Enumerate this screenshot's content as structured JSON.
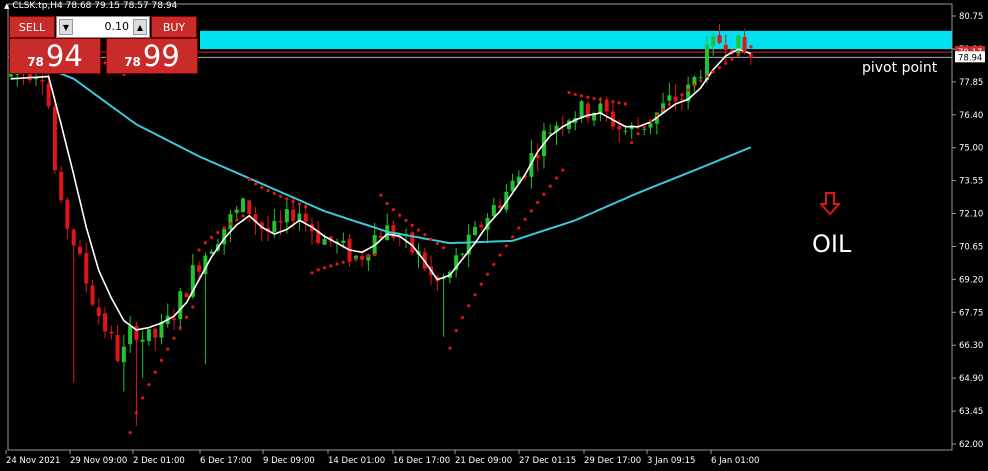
{
  "header": {
    "symbol_info": "CLSK.tp,H4",
    "ohlc": "78.68 79.15 78.57 78.94"
  },
  "trade_panel": {
    "sell_label": "SELL",
    "buy_label": "BUY",
    "volume": "0.10",
    "sell_price_prefix": "78",
    "sell_price_big": "94",
    "buy_price_prefix": "78",
    "buy_price_big": "99"
  },
  "annotations": {
    "pivot_label": "pivot point",
    "oil_label": "OIL"
  },
  "colors": {
    "bull": "#22c32e",
    "bear": "#e01515",
    "ma_slow": "#3cc8d8",
    "ma_fast": "#ffffff",
    "psar": "#e01515",
    "pivot_zone": "#00e0f0",
    "price_tag": "#c92a2a"
  },
  "chart_data": {
    "type": "candlestick",
    "title": "",
    "ylim": [
      62.0,
      81.2
    ],
    "y_ticks": [
      "80.75",
      "79.30",
      "77.85",
      "76.40",
      "75.00",
      "73.55",
      "72.10",
      "70.65",
      "69.20",
      "67.75",
      "66.30",
      "64.90",
      "63.45",
      "62.00"
    ],
    "x_ticks": [
      "24 Nov 2021",
      "29 Nov 09:00",
      "2 Dec 01:00",
      "6 Dec 17:00",
      "9 Dec 09:00",
      "14 Dec 01:00",
      "16 Dec 17:00",
      "21 Dec 09:00",
      "27 Dec 01:15",
      "29 Dec 17:00",
      "3 Jan 09:15",
      "6 Jan 01:00"
    ],
    "bar_count": 120,
    "current_price": "78.94",
    "price_marker_2": "79.17",
    "pivot_zone": [
      79.3,
      80.1
    ],
    "pivot_line": 79.17,
    "price_path": [
      [
        0,
        78.1
      ],
      [
        4,
        78.4
      ],
      [
        6,
        78.3
      ],
      [
        8,
        72.5
      ],
      [
        10,
        71.3
      ],
      [
        12,
        69.5
      ],
      [
        14,
        68.0
      ],
      [
        16,
        66.8
      ],
      [
        18,
        65.6
      ],
      [
        20,
        67.2
      ],
      [
        22,
        66.5
      ],
      [
        24,
        66.8
      ],
      [
        26,
        67.5
      ],
      [
        28,
        68.6
      ],
      [
        30,
        69.8
      ],
      [
        33,
        71.0
      ],
      [
        36,
        72.0
      ],
      [
        38,
        72.5
      ],
      [
        40,
        71.6
      ],
      [
        42,
        71.2
      ],
      [
        44,
        71.6
      ],
      [
        46,
        72.4
      ],
      [
        48,
        71.6
      ],
      [
        50,
        71.0
      ],
      [
        52,
        70.8
      ],
      [
        54,
        70.4
      ],
      [
        56,
        70.1
      ],
      [
        58,
        71.0
      ],
      [
        60,
        71.4
      ],
      [
        62,
        71.2
      ],
      [
        64,
        70.6
      ],
      [
        66,
        70.1
      ],
      [
        68,
        69.0
      ],
      [
        70,
        69.2
      ],
      [
        72,
        70.3
      ],
      [
        74,
        70.9
      ],
      [
        76,
        71.9
      ],
      [
        78,
        72.5
      ],
      [
        80,
        73.2
      ],
      [
        82,
        73.9
      ],
      [
        84,
        74.8
      ],
      [
        86,
        75.7
      ],
      [
        88,
        76.2
      ],
      [
        90,
        76.5
      ],
      [
        92,
        76.6
      ],
      [
        94,
        76.7
      ],
      [
        96,
        76.3
      ],
      [
        98,
        75.7
      ],
      [
        100,
        75.8
      ],
      [
        102,
        76.1
      ],
      [
        104,
        76.6
      ],
      [
        106,
        77.1
      ],
      [
        108,
        77.2
      ],
      [
        110,
        78.2
      ],
      [
        112,
        79.3
      ],
      [
        114,
        79.8
      ],
      [
        116,
        79.6
      ],
      [
        117,
        79.2
      ],
      [
        118,
        78.94
      ]
    ],
    "spikes": [
      [
        10,
        64.7
      ],
      [
        18,
        64.3
      ],
      [
        20,
        62.8
      ],
      [
        21,
        64.9
      ],
      [
        31,
        65.5
      ],
      [
        69,
        66.7
      ],
      [
        97,
        75.2
      ]
    ],
    "ma_slow_path": [
      [
        0,
        79.1
      ],
      [
        10,
        78.0
      ],
      [
        20,
        76.0
      ],
      [
        30,
        74.6
      ],
      [
        40,
        73.4
      ],
      [
        50,
        72.2
      ],
      [
        60,
        71.3
      ],
      [
        70,
        70.8
      ],
      [
        80,
        70.9
      ],
      [
        90,
        71.8
      ],
      [
        100,
        73.0
      ],
      [
        110,
        74.1
      ],
      [
        118,
        75.0
      ]
    ],
    "ma_fast_path": [
      [
        0,
        78.0
      ],
      [
        6,
        78.1
      ],
      [
        8,
        76.0
      ],
      [
        10,
        73.8
      ],
      [
        12,
        71.5
      ],
      [
        14,
        69.6
      ],
      [
        16,
        68.4
      ],
      [
        18,
        67.4
      ],
      [
        20,
        67.0
      ],
      [
        22,
        67.1
      ],
      [
        24,
        67.3
      ],
      [
        26,
        67.6
      ],
      [
        28,
        68.2
      ],
      [
        30,
        69.2
      ],
      [
        32,
        70.2
      ],
      [
        34,
        71.0
      ],
      [
        36,
        71.6
      ],
      [
        38,
        72.0
      ],
      [
        40,
        71.5
      ],
      [
        42,
        71.2
      ],
      [
        44,
        71.4
      ],
      [
        46,
        71.8
      ],
      [
        48,
        71.5
      ],
      [
        50,
        71.1
      ],
      [
        52,
        70.8
      ],
      [
        54,
        70.5
      ],
      [
        56,
        70.4
      ],
      [
        58,
        70.7
      ],
      [
        60,
        71.2
      ],
      [
        62,
        71.1
      ],
      [
        64,
        70.7
      ],
      [
        66,
        70.0
      ],
      [
        68,
        69.2
      ],
      [
        70,
        69.4
      ],
      [
        72,
        70.1
      ],
      [
        74,
        70.8
      ],
      [
        76,
        71.6
      ],
      [
        78,
        72.2
      ],
      [
        80,
        73.0
      ],
      [
        82,
        73.8
      ],
      [
        84,
        74.8
      ],
      [
        86,
        75.5
      ],
      [
        88,
        75.9
      ],
      [
        90,
        76.2
      ],
      [
        92,
        76.4
      ],
      [
        94,
        76.5
      ],
      [
        96,
        76.2
      ],
      [
        98,
        75.9
      ],
      [
        100,
        75.9
      ],
      [
        102,
        76.1
      ],
      [
        104,
        76.5
      ],
      [
        106,
        76.9
      ],
      [
        108,
        77.1
      ],
      [
        110,
        77.6
      ],
      [
        112,
        78.4
      ],
      [
        114,
        79.0
      ],
      [
        116,
        79.3
      ],
      [
        118,
        79.1
      ]
    ],
    "psar_runs": [
      [
        9,
        18,
        80.0,
        78.2,
        "above"
      ],
      [
        19,
        29,
        62.5,
        68.0,
        "below"
      ],
      [
        30,
        37,
        70.5,
        72.0,
        "below"
      ],
      [
        38,
        47,
        73.6,
        72.4,
        "above"
      ],
      [
        48,
        58,
        69.5,
        70.3,
        "below"
      ],
      [
        59,
        69,
        72.9,
        70.6,
        "above"
      ],
      [
        70,
        88,
        66.2,
        74.0,
        "below"
      ],
      [
        89,
        98,
        77.4,
        76.9,
        "above"
      ],
      [
        99,
        118,
        75.2,
        79.4,
        "below"
      ]
    ]
  }
}
